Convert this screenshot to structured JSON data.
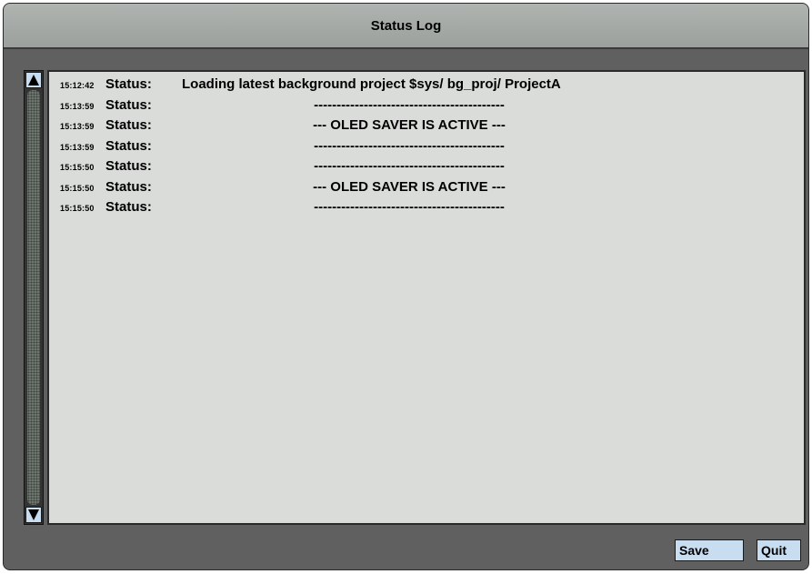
{
  "window": {
    "title": "Status Log"
  },
  "log": [
    {
      "time": "15:12:42",
      "status": "Status:",
      "message": "Loading latest background project $sys/ bg_proj/ ProjectA",
      "centered": false
    },
    {
      "time": "15:13:59",
      "status": "Status:",
      "message": "------------------------------------------",
      "centered": true
    },
    {
      "time": "15:13:59",
      "status": "Status:",
      "message": "--- OLED SAVER IS ACTIVE ---",
      "centered": true
    },
    {
      "time": "15:13:59",
      "status": "Status:",
      "message": "------------------------------------------",
      "centered": true
    },
    {
      "time": "15:15:50",
      "status": "Status:",
      "message": "------------------------------------------",
      "centered": true
    },
    {
      "time": "15:15:50",
      "status": "Status:",
      "message": "--- OLED SAVER IS ACTIVE ---",
      "centered": true
    },
    {
      "time": "15:15:50",
      "status": "Status:",
      "message": "------------------------------------------",
      "centered": true
    }
  ],
  "buttons": {
    "save_label": "Save",
    "quit_label": "Quit"
  },
  "icons": {
    "scroll_up": "arrow-up-icon",
    "scroll_down": "arrow-down-icon"
  },
  "colors": {
    "button_bg": "#c8ddf0",
    "log_bg": "#d9dcd9",
    "frame_bg": "#606060",
    "title_bg": "#a8aca9"
  }
}
